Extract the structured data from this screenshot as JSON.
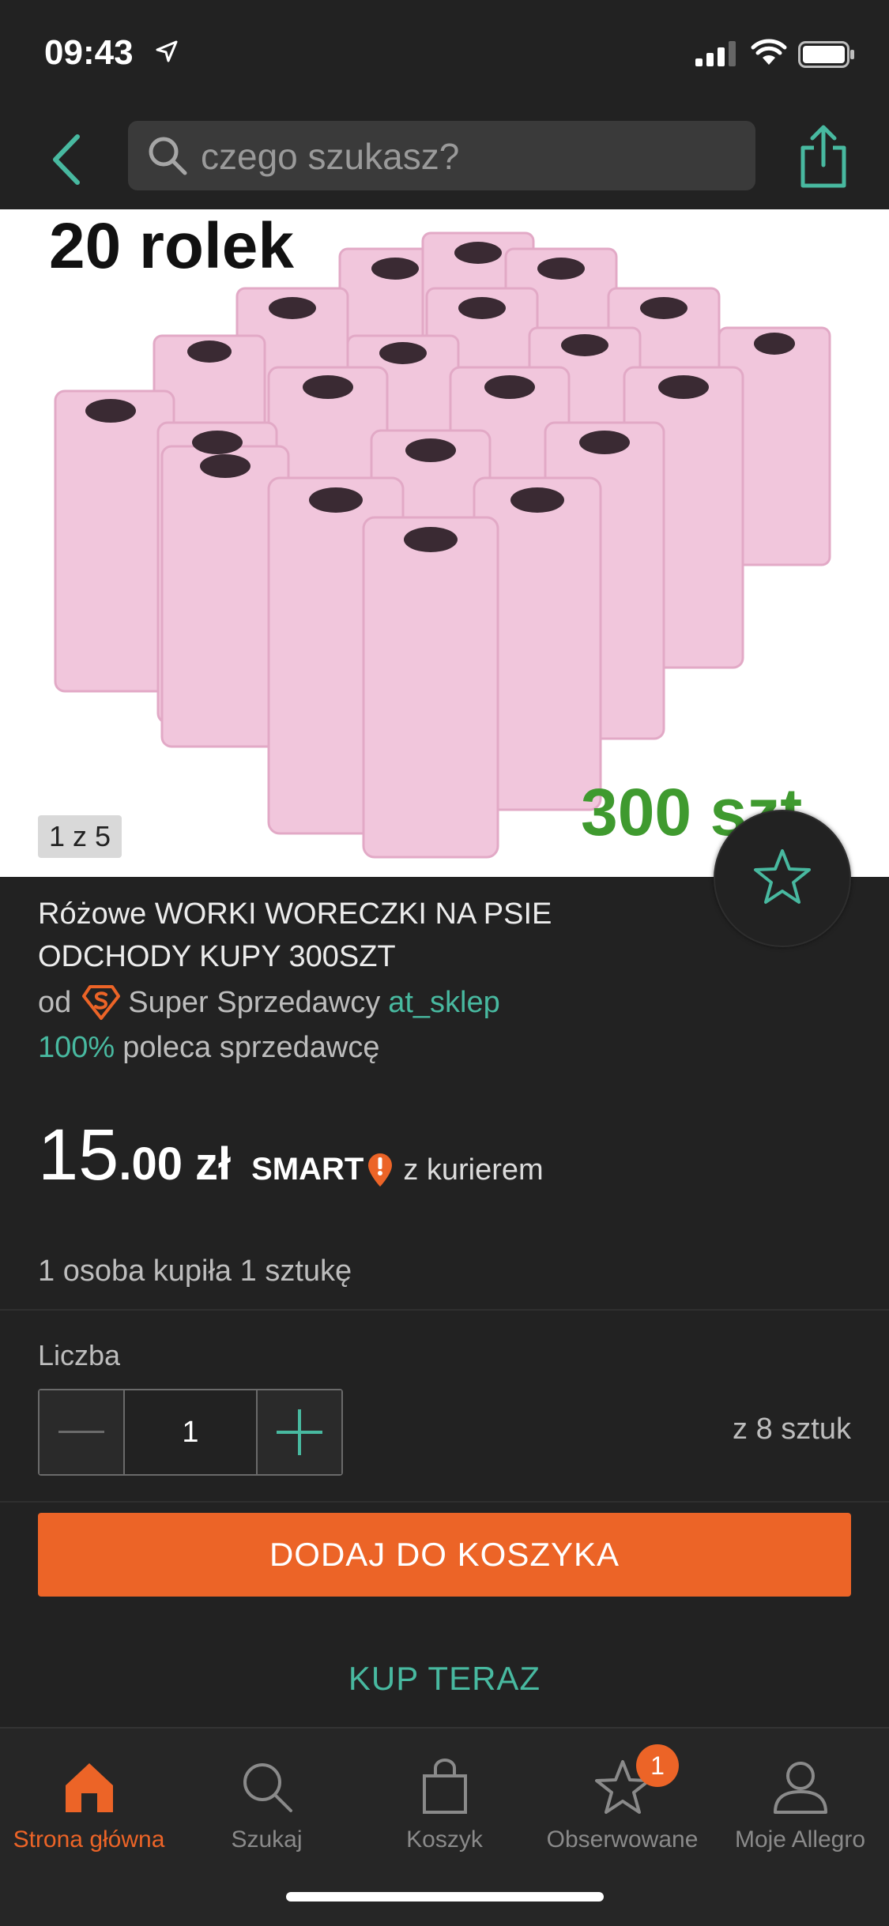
{
  "status_bar": {
    "time": "09:43"
  },
  "search": {
    "placeholder": "czego szukasz?"
  },
  "image": {
    "caption_top": "20 rolek",
    "caption_bottom": "300 szt",
    "counter": "1 z 5"
  },
  "product": {
    "title": "Różowe WORKI WORECZKI NA PSIE ODCHODY KUPY 300SZT",
    "seller_prefix": "od",
    "seller_type": "Super Sprzedawcy",
    "seller_name": "at_sklep",
    "recommend_pct": "100%",
    "recommend_text": "poleca sprzedawcę",
    "price_int": "15",
    "price_dec": ".00",
    "currency": "zł",
    "smart_label": "SMART",
    "delivery_text": "z kurierem",
    "buyers_text": "1 osoba kupiła 1 sztukę"
  },
  "quantity": {
    "label": "Liczba",
    "value": "1",
    "stock_text": "z 8 sztuk"
  },
  "actions": {
    "add_to_cart": "DODAJ DO KOSZYKA",
    "buy_now": "KUP TERAZ"
  },
  "tabs": [
    {
      "label": "Strona główna",
      "icon": "home-icon",
      "active": true
    },
    {
      "label": "Szukaj",
      "icon": "search-icon"
    },
    {
      "label": "Koszyk",
      "icon": "cart-icon"
    },
    {
      "label": "Obserwowane",
      "icon": "star-icon",
      "badge": "1"
    },
    {
      "label": "Moje Allegro",
      "icon": "user-icon"
    }
  ],
  "colors": {
    "accent": "#48b9a0",
    "brand_orange": "#ec6427",
    "background": "#222222"
  }
}
